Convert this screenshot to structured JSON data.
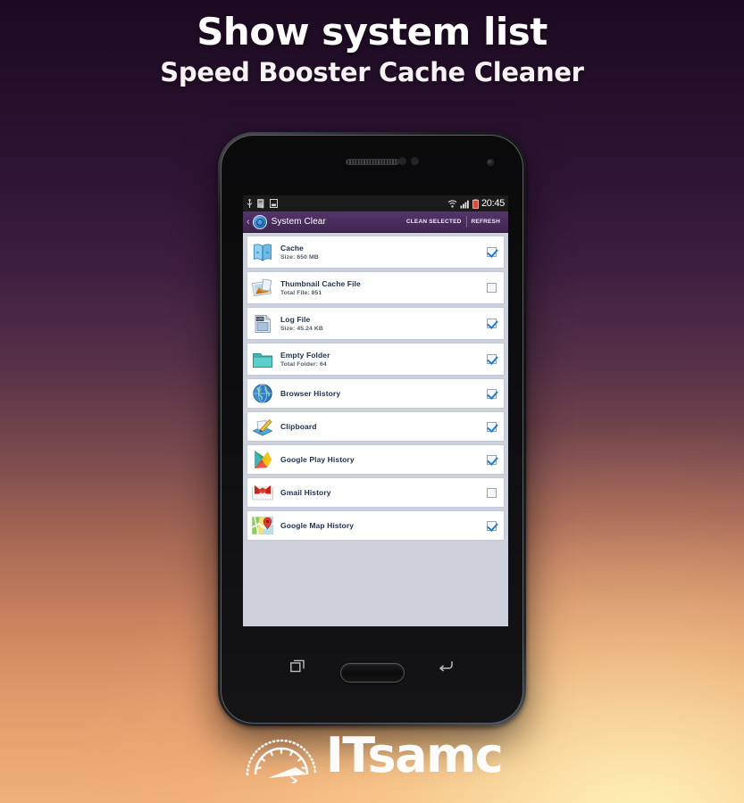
{
  "page": {
    "title_main": "Show system list",
    "title_sub": "Speed Booster Cache Cleaner",
    "bg_top_color": "#1d0a22",
    "bg_bottom_color": "#efb079"
  },
  "phone": {
    "statusbar": {
      "left_icons": [
        "usb-icon",
        "document-error-icon",
        "sd-card-icon"
      ],
      "right_icons": [
        "wifi-icon",
        "signal-bars-icon",
        "battery-low-icon"
      ],
      "clock": "20:45"
    },
    "appbar": {
      "back_label": "‹",
      "app_icon": "system-clear-app-icon",
      "title": "System Clear",
      "action_clean": "CLEAN SELECTED",
      "action_refresh": "REFRESH",
      "bg_color": "#4a2c5e"
    },
    "navbar": {
      "recents_label": "recents",
      "home_label": "home",
      "back_label": "back"
    }
  },
  "list": {
    "items": [
      {
        "icon": "book-icon",
        "title": "Cache",
        "subtitle": "Size: 650 MB",
        "checked": true
      },
      {
        "icon": "photo-stack-icon",
        "title": "Thumbnail Cache File",
        "subtitle": "Total File: 851",
        "checked": false
      },
      {
        "icon": "log-document-icon",
        "title": "Log File",
        "subtitle": "Size: 45.24 KB",
        "checked": true
      },
      {
        "icon": "folder-icon",
        "title": "Empty Folder",
        "subtitle": "Total Folder: 64",
        "checked": true
      },
      {
        "icon": "globe-icon",
        "title": "Browser History",
        "subtitle": "",
        "checked": true
      },
      {
        "icon": "clipboard-icon",
        "title": "Clipboard",
        "subtitle": "",
        "checked": true
      },
      {
        "icon": "google-play-icon",
        "title": "Google Play History",
        "subtitle": "",
        "checked": true
      },
      {
        "icon": "gmail-icon",
        "title": "Gmail History",
        "subtitle": "",
        "checked": false
      },
      {
        "icon": "google-maps-icon",
        "title": "Google Map History",
        "subtitle": "",
        "checked": true
      }
    ]
  },
  "footer": {
    "logo_mark": "speedometer-gauge-icon",
    "logo_text": "ITsamc"
  }
}
